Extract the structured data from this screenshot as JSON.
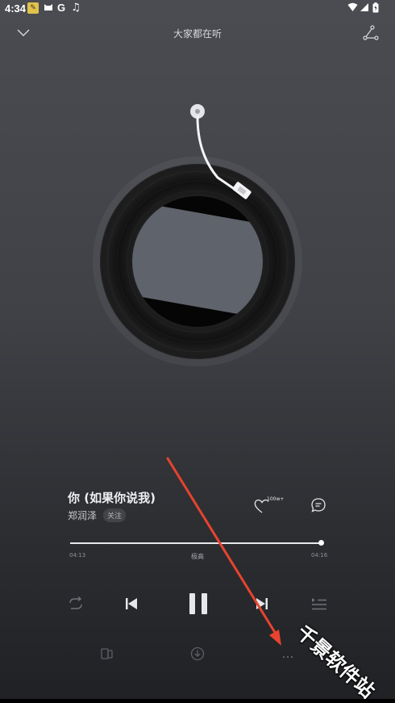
{
  "status_bar": {
    "time": "4:34",
    "icons": [
      "notification-icon",
      "cat-icon",
      "google-icon",
      "music-note-icon"
    ],
    "right_icons": [
      "wifi-icon",
      "signal-icon",
      "battery-icon"
    ]
  },
  "header": {
    "title": "大家都在听",
    "left_icon": "chevron-down-icon",
    "right_icon": "share-icon"
  },
  "song": {
    "title": "你 (如果你说我)",
    "artist": "郑润泽",
    "follow_label": "关注",
    "likes": "100w+"
  },
  "progress": {
    "current": "04:13",
    "total": "04:16",
    "quality": "极高",
    "fraction": 0.99
  },
  "controls": [
    "repeat-icon",
    "previous-icon",
    "pause-icon",
    "next-icon",
    "playlist-icon"
  ],
  "bottom_actions": [
    "phone-icon",
    "download-icon",
    "more-icon"
  ],
  "watermark": "千景软件站",
  "colors": {
    "annotation_arrow": "#e8432f",
    "background_top": "#4a4c52",
    "background_bottom": "#1f2124"
  }
}
